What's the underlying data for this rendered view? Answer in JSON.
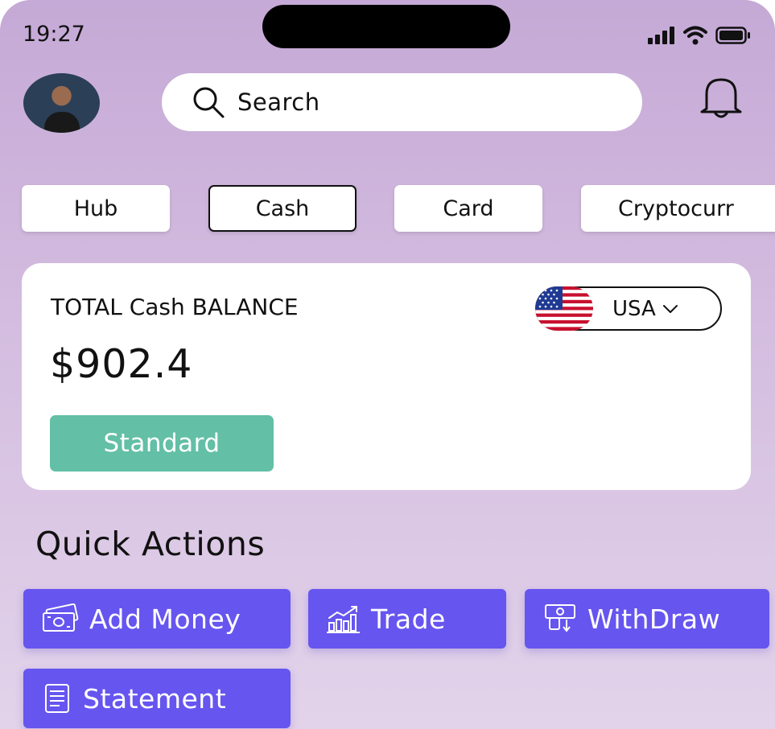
{
  "status_bar": {
    "time": "19:27"
  },
  "header": {
    "search_label": "Search"
  },
  "tabs": [
    "Hub",
    "Cash",
    "Card",
    "Cryptocurr"
  ],
  "balance": {
    "title": "TOTAL Cash  BALANCE",
    "amount": "$902.4",
    "plan": "Standard",
    "currency": "USA"
  },
  "quick_actions": {
    "title": "Quick Actions",
    "items": [
      "Add Money",
      "Trade",
      "WithDraw",
      "Statement"
    ]
  },
  "colors": {
    "accent": "#6655ef",
    "plan_badge": "#63bfa6",
    "background_top": "#c5a9d6",
    "background_bottom": "#e2d3ea"
  },
  "icons": [
    "signal-icon",
    "wifi-icon",
    "battery-icon",
    "search-icon",
    "bell-icon",
    "us-flag-icon",
    "chevron-down-icon",
    "money-icon",
    "chart-icon",
    "withdraw-icon",
    "statement-icon"
  ]
}
